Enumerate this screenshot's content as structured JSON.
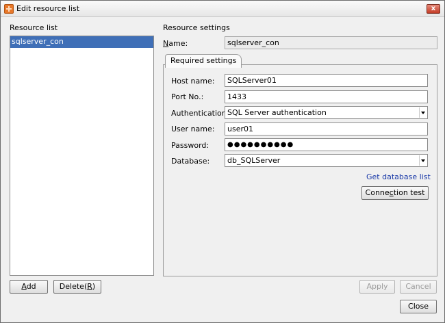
{
  "window": {
    "title": "Edit resource list",
    "close_glyph": "x"
  },
  "left": {
    "header": "Resource list",
    "items": [
      "sqlserver_con"
    ],
    "add_pre": "",
    "add_key": "A",
    "add_post": "dd",
    "delete_pre": "Delete(",
    "delete_key": "R",
    "delete_post": ")"
  },
  "right": {
    "header": "Resource settings",
    "name_key": "N",
    "name_rest": "ame:",
    "name_value": "sqlserver_con",
    "tab_label": "Required settings",
    "host_label": "Host name:",
    "host_value": "SQLServer01",
    "port_label": "Port No.:",
    "port_value": "1433",
    "auth_label": "Authentication:",
    "auth_value": "SQL Server authentication",
    "user_label": "User name:",
    "user_value": "user01",
    "pwd_label": "Password:",
    "pwd_value": "●●●●●●●●●●",
    "db_label": "Database:",
    "db_value": "db_SQLServer",
    "get_db_link": "Get database list",
    "conn_pre": "Conne",
    "conn_key": "c",
    "conn_post": "tion test"
  },
  "footer": {
    "apply_label": "Apply",
    "cancel_label": "Cancel",
    "close_label": "Close"
  },
  "colors": {
    "selection": "#3f6fb7",
    "link": "#1a3aa8"
  }
}
